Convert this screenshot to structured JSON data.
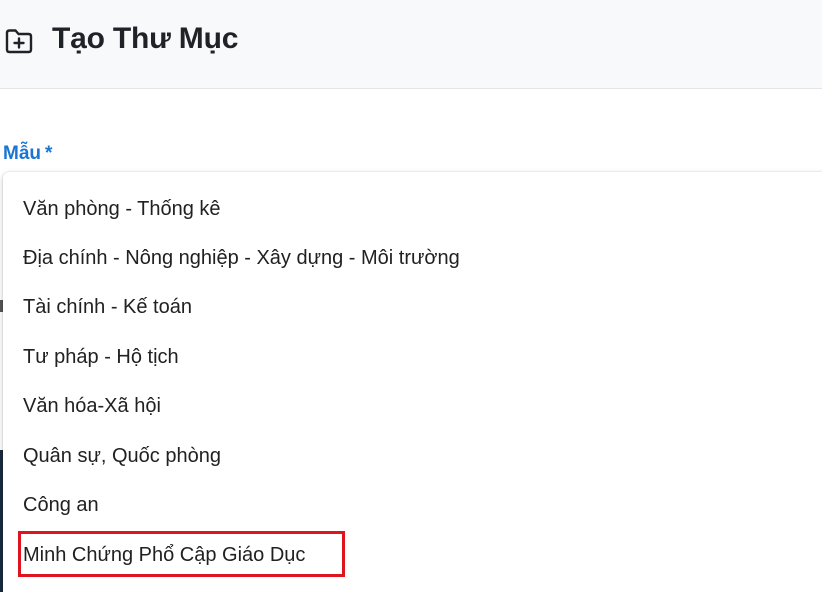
{
  "header": {
    "title": "Tạo Thư Mục",
    "icon": "folder-plus-icon"
  },
  "form": {
    "template_label": "Mẫu",
    "required_mark": "*"
  },
  "dropdown": {
    "options": [
      "Văn phòng - Thống kê",
      "Địa chính - Nông nghiệp - Xây dựng - Môi trường",
      "Tài chính - Kế toán",
      "Tư pháp - Hộ tịch",
      "Văn hóa-Xã hội",
      "Quân sự, Quốc phòng",
      "Công an",
      "Minh Chứng Phổ Cập Giáo Dục"
    ],
    "highlighted_option": "Minh Chứng Phổ Cập Giáo Dục"
  },
  "colors": {
    "label_blue": "#1976d2",
    "highlight_red": "#e0141e",
    "header_bg": "#f8f9fb"
  }
}
